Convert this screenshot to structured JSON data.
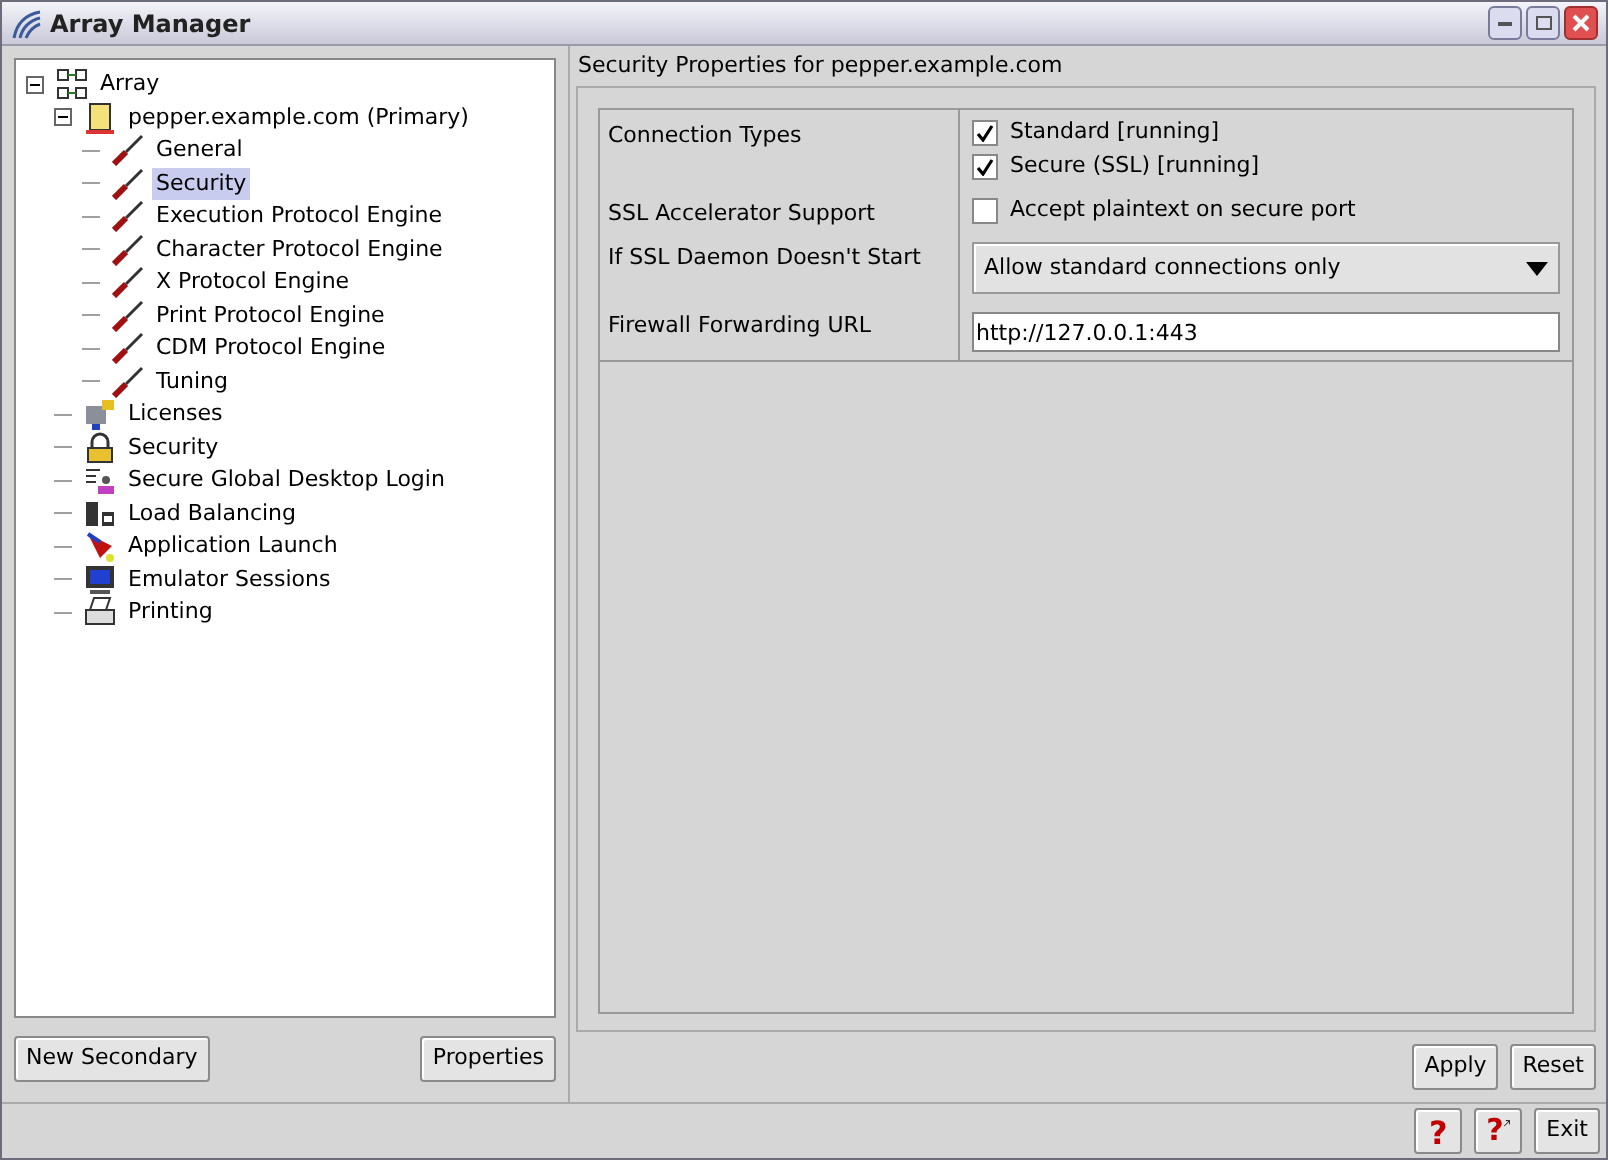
{
  "window": {
    "title": "Array Manager"
  },
  "tree": [
    {
      "label": "Array",
      "kind": "array",
      "expanded": true,
      "selected": false,
      "children": [
        {
          "label": "pepper.example.com (Primary)",
          "kind": "server",
          "expanded": true,
          "selected": false,
          "children": [
            {
              "label": "General",
              "kind": "tool",
              "selected": false
            },
            {
              "label": "Security",
              "kind": "tool",
              "selected": true
            },
            {
              "label": "Execution Protocol Engine",
              "kind": "tool",
              "selected": false
            },
            {
              "label": "Character Protocol Engine",
              "kind": "tool",
              "selected": false
            },
            {
              "label": "X Protocol Engine",
              "kind": "tool",
              "selected": false
            },
            {
              "label": "Print Protocol Engine",
              "kind": "tool",
              "selected": false
            },
            {
              "label": "CDM Protocol Engine",
              "kind": "tool",
              "selected": false
            },
            {
              "label": "Tuning",
              "kind": "tool",
              "selected": false
            }
          ]
        },
        {
          "label": "Licenses",
          "kind": "key",
          "selected": false
        },
        {
          "label": "Security",
          "kind": "lock",
          "selected": false
        },
        {
          "label": "Secure Global Desktop Login",
          "kind": "login",
          "selected": false
        },
        {
          "label": "Load Balancing",
          "kind": "balance",
          "selected": false
        },
        {
          "label": "Application Launch",
          "kind": "rocket",
          "selected": false
        },
        {
          "label": "Emulator Sessions",
          "kind": "monitor",
          "selected": false
        },
        {
          "label": "Printing",
          "kind": "printer",
          "selected": false
        }
      ]
    }
  ],
  "left_buttons": [
    "New Secondary",
    "Properties"
  ],
  "panel": {
    "title": "Security Properties for pepper.example.com",
    "rows": [
      {
        "label": "Connection Types",
        "kind": "checkboxes",
        "options": [
          {
            "label": "Standard [running]",
            "checked": true
          },
          {
            "label": "Secure (SSL) [running]",
            "checked": true
          }
        ]
      },
      {
        "label": "SSL Accelerator Support",
        "kind": "checkboxes",
        "options": [
          {
            "label": "Accept plaintext on secure port",
            "checked": false
          }
        ]
      },
      {
        "label": "If SSL Daemon Doesn't Start",
        "kind": "dropdown",
        "value": "Allow standard connections only"
      },
      {
        "label": "Firewall Forwarding URL",
        "kind": "text",
        "value": "http://127.0.0.1:443"
      }
    ]
  },
  "panel_buttons": [
    "Apply",
    "Reset"
  ],
  "footer": {
    "help": "?",
    "context_help": "?",
    "exit": "Exit"
  }
}
